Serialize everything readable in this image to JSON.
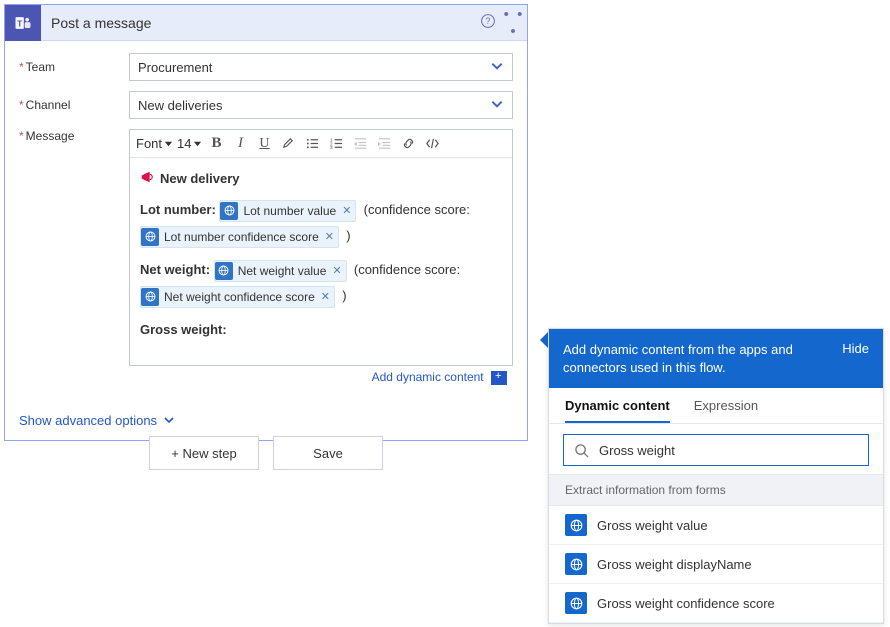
{
  "card": {
    "title": "Post a message",
    "logo_text": "T",
    "help_glyph": "?",
    "ellipsis": "• • •"
  },
  "fields": {
    "team": {
      "label": "Team",
      "value": "Procurement"
    },
    "channel": {
      "label": "Channel",
      "value": "New deliveries"
    },
    "message_label": "Message"
  },
  "toolbar": {
    "font_label": "Font",
    "size_label": "14"
  },
  "message": {
    "heading": "New delivery",
    "lot_label": "Lot number:",
    "netw_label": "Net weight:",
    "grossw_label": "Gross weight:",
    "conf_prefix": "(confidence score:",
    "conf_suffix": ")",
    "pills": {
      "lot_value": "Lot number value",
      "lot_conf": "Lot number confidence score",
      "netw_value": "Net weight value",
      "netw_conf": "Net weight confidence score"
    }
  },
  "links": {
    "add_dc": "Add dynamic content",
    "show_adv": "Show advanced options"
  },
  "footer": {
    "new_step": "+ New step",
    "save": "Save"
  },
  "dc_panel": {
    "header_text": "Add dynamic content from the apps and connectors used in this flow.",
    "hide": "Hide",
    "tab_dynamic": "Dynamic content",
    "tab_expression": "Expression",
    "search_value": "Gross weight",
    "section_title": "Extract information from forms",
    "items": [
      "Gross weight value",
      "Gross weight displayName",
      "Gross weight confidence score"
    ]
  }
}
